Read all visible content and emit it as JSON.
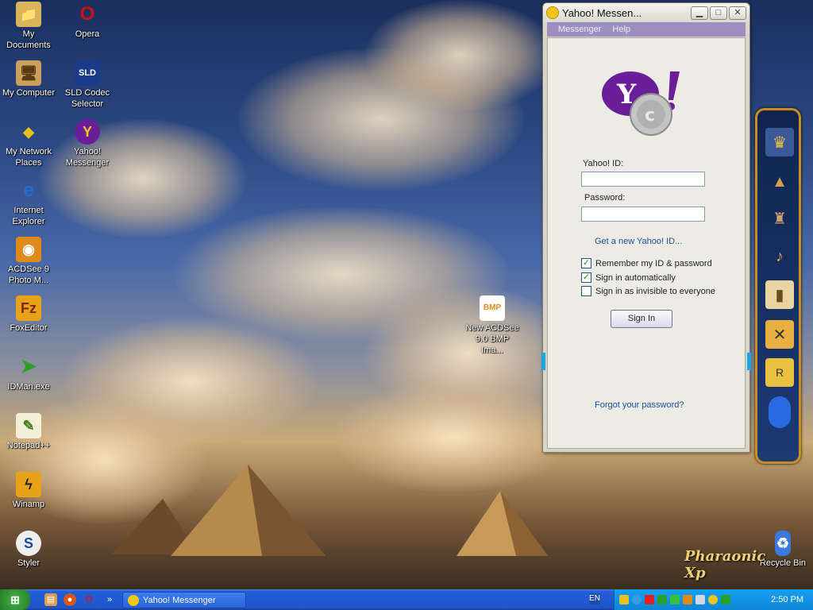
{
  "desktop": {
    "icons": [
      {
        "label": "My Documents"
      },
      {
        "label": "Opera"
      },
      {
        "label": "My Computer"
      },
      {
        "label": "SLD Codec Selector"
      },
      {
        "label": "My Network Places"
      },
      {
        "label": "Yahoo! Messenger"
      },
      {
        "label": "Internet Explorer"
      },
      {
        "label": "ACDSee 9 Photo M..."
      },
      {
        "label": "FoxEditor"
      },
      {
        "label": "IDMan.exe"
      },
      {
        "label": "Notepad++"
      },
      {
        "label": "Winamp"
      },
      {
        "label": "Styler"
      },
      {
        "label": "New ACDSee 9.0 BMP Ima..."
      },
      {
        "label": "Recycle Bin"
      }
    ],
    "brand": "Pharaonic Xp"
  },
  "window": {
    "title": "Yahoo! Messen...",
    "menu": [
      "Messenger",
      "Help"
    ],
    "yahoo_id_label": "Yahoo! ID:",
    "yahoo_id_value": "",
    "password_label": "Password:",
    "password_value": "",
    "new_id_link": "Get a new Yahoo! ID...",
    "checks": [
      {
        "label": "Remember my ID & password",
        "checked": true
      },
      {
        "label": "Sign in automatically",
        "checked": true
      },
      {
        "label": "Sign in as invisible to everyone",
        "checked": false
      }
    ],
    "sign_in": "Sign In",
    "forgot_link": "Forgot your password?"
  },
  "taskbar": {
    "task": "Yahoo! Messenger",
    "language": "EN",
    "clock": "2:50 PM"
  },
  "colors": {
    "yahoo_purple": "#6b1e99",
    "link": "#1b4ea0",
    "taskbar": "#245edb"
  }
}
